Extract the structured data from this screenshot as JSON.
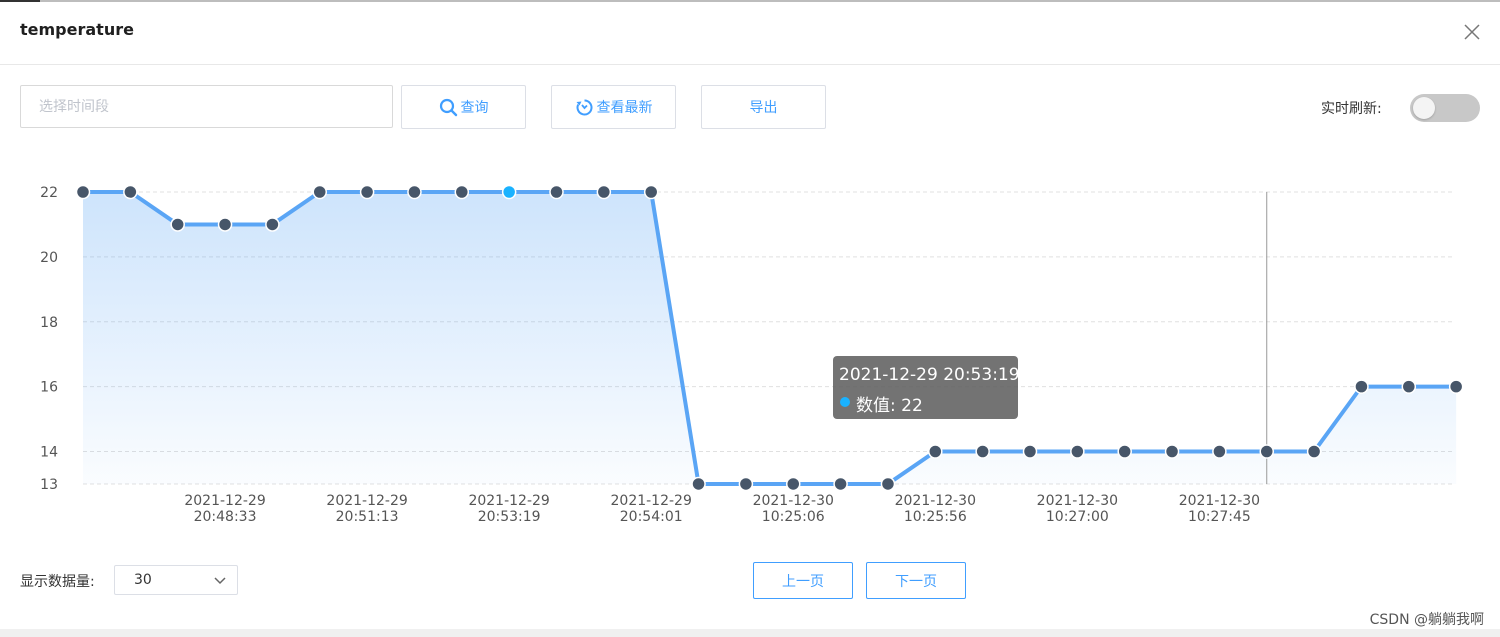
{
  "dialog": {
    "title": "temperature"
  },
  "toolbar": {
    "time_placeholder": "选择时间段",
    "query_label": "查询",
    "latest_label": "查看最新",
    "export_label": "导出",
    "realtime_label": "实时刷新:",
    "realtime_on": false
  },
  "icons": {
    "close": "close-icon",
    "search": "search-icon",
    "refresh": "refresh-icon",
    "chevron": "chevron-down-icon"
  },
  "colors": {
    "accent": "#409eff",
    "line": "#5aa5f5",
    "point": "#475669",
    "highlight": "#1ab2ff"
  },
  "chart_data": {
    "type": "area",
    "ylim": [
      13,
      22
    ],
    "yticks": [
      13,
      14,
      16,
      18,
      20,
      22
    ],
    "grid": true,
    "values": [
      22,
      22,
      21,
      21,
      21,
      22,
      22,
      22,
      22,
      22,
      22,
      22,
      22,
      13,
      13,
      13,
      13,
      13,
      14,
      14,
      14,
      14,
      14,
      14,
      14,
      14,
      14,
      16,
      16,
      16
    ],
    "xtick_labels": [
      {
        "index": 3,
        "date": "2021-12-29",
        "time": "20:48:33"
      },
      {
        "index": 6,
        "date": "2021-12-29",
        "time": "20:51:13"
      },
      {
        "index": 9,
        "date": "2021-12-29",
        "time": "20:53:19"
      },
      {
        "index": 12,
        "date": "2021-12-29",
        "time": "20:54:01"
      },
      {
        "index": 15,
        "date": "2021-12-30",
        "time": "10:25:06"
      },
      {
        "index": 18,
        "date": "2021-12-30",
        "time": "10:25:56"
      },
      {
        "index": 21,
        "date": "2021-12-30",
        "time": "10:27:00"
      },
      {
        "index": 24,
        "date": "2021-12-30",
        "time": "10:27:45"
      }
    ],
    "highlighted_index": 9,
    "cursor_index": 25
  },
  "tooltip": {
    "time": "2021-12-29 20:53:19",
    "value_text": "数值: 22"
  },
  "footer": {
    "count_label": "显示数据量:",
    "count_value": "30",
    "prev_label": "上一页",
    "next_label": "下一页"
  },
  "watermark": "CSDN @躺躺我啊"
}
